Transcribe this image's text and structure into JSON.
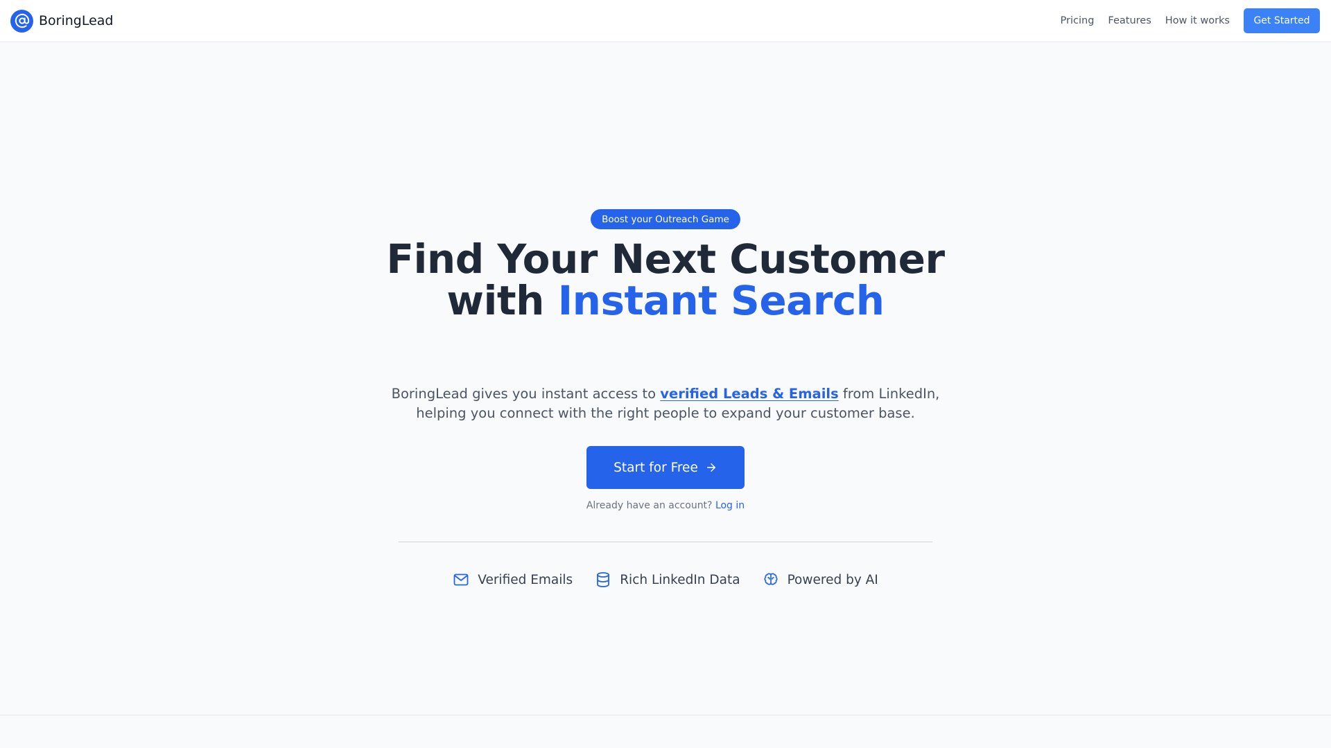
{
  "nav": {
    "brand_name": "BoringLead",
    "links": [
      "Pricing",
      "Features",
      "How it works"
    ],
    "cta_label": "Get Started"
  },
  "hero": {
    "badge": "Boost your Outreach Game",
    "headline_line1": "Find Your Next Customer",
    "headline_line2_prefix": "with ",
    "headline_line2_accent": "Instant Search",
    "subtext_before": "BoringLead gives you instant access to ",
    "subtext_highlight": "verified Leads & Emails",
    "subtext_after": " from LinkedIn, helping you connect with the right people to expand your customer base.",
    "cta_label": "Start for Free",
    "login_prompt": "Already have an account?",
    "login_link": "Log in"
  },
  "features": [
    {
      "icon": "mail-icon",
      "label": "Verified Emails"
    },
    {
      "icon": "database-icon",
      "label": "Rich LinkedIn Data"
    },
    {
      "icon": "brain-icon",
      "label": "Powered by AI"
    }
  ],
  "colors": {
    "primary": "#2563eb",
    "button_light": "#3b82f6",
    "background": "#f8fafc",
    "heading": "#1f2937",
    "body_text": "#4b5563"
  }
}
